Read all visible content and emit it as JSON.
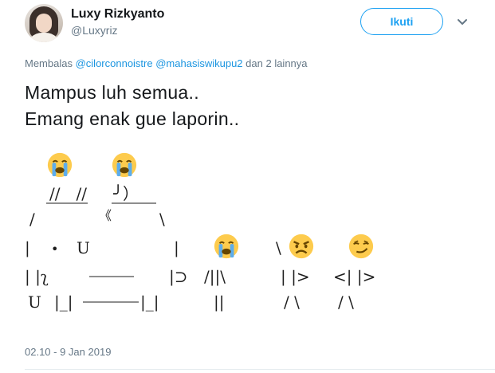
{
  "author": {
    "name": "Luxy Rizkyanto",
    "handle": "@Luxyriz"
  },
  "follow_button": {
    "label": "Ikuti"
  },
  "menu": {
    "icon": "chevron-down-icon"
  },
  "reply": {
    "prefix": "Membalas",
    "mention_1": "@cilorconnoistre",
    "mention_2": "@mahasiswikupu2",
    "suffix": "dan 2 lainnya"
  },
  "tweet_text": {
    "line_1": "Mampus luh semua..",
    "line_2": "Emang enak gue laporin.."
  },
  "ascii_art": {
    "row_1": "//　//",
    "row_1b": "╯）",
    "row_2_left": "/",
    "row_2_mid": "《",
    "row_2_right": "\\",
    "row_3_left": "|",
    "row_3_dot": "•",
    "row_3_u": "U",
    "row_3_right": "|",
    "fig1_row_3": "\\",
    "row_4_left": "| |ʅ",
    "row_4_right": "|⊃",
    "fig0_row_4": "/||\\",
    "fig1_row_4": "| |>",
    "fig2_row_4": "<| |>",
    "row_5_u": "U",
    "row_5_a": "|_|",
    "row_5_b": "|_|",
    "fig0_row_5": "||",
    "fig1_row_5": "/ \\",
    "fig2_row_5": "/ \\"
  },
  "emojis": {
    "crying": "loudly-crying-face",
    "angry": "angry-face",
    "smirk": "smirking-face"
  },
  "colors": {
    "accent": "#1da1f2",
    "link": "#1b95e0",
    "secondary_text": "#657786",
    "emoji_face": "#fdcb4d"
  },
  "timestamp": "02.10 - 9 Jan 2019"
}
